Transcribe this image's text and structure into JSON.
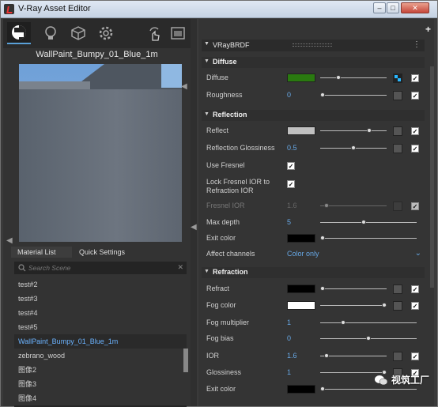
{
  "window": {
    "title": "V-Ray Asset Editor"
  },
  "toolbar": {
    "icons": [
      "materials-icon",
      "lights-icon",
      "geometry-icon",
      "settings-icon",
      "render-interactive-icon",
      "frame-buffer-icon"
    ]
  },
  "preview": {
    "title": "WallPaint_Bumpy_01_Blue_1m"
  },
  "left_tabs": [
    {
      "label": "Material List"
    },
    {
      "label": "Quick Settings"
    }
  ],
  "search": {
    "placeholder": "Search Scene"
  },
  "materials": [
    {
      "label": "test#2"
    },
    {
      "label": "test#3"
    },
    {
      "label": "test#4"
    },
    {
      "label": "test#5"
    },
    {
      "label": "WallPaint_Bumpy_01_Blue_1m",
      "selected": true
    },
    {
      "label": "zebrano_wood"
    },
    {
      "label": "图像2"
    },
    {
      "label": "图像3"
    },
    {
      "label": "图像4"
    }
  ],
  "editor": {
    "plus": "+",
    "header": "VRayBRDF",
    "menu": "⋮",
    "diffuse": {
      "title": "Diffuse",
      "diffuse_label": "Diffuse",
      "diffuse_color": "#2a7a10",
      "diffuse_slider": 0.25,
      "roughness_label": "Roughness",
      "roughness_value": "0",
      "roughness_slider": 0.0
    },
    "reflection": {
      "title": "Reflection",
      "reflect_label": "Reflect",
      "reflect_color": "#c0c0c0",
      "reflect_slider": 0.75,
      "gloss_label": "Reflection Glossiness",
      "gloss_value": "0.5",
      "gloss_slider": 0.5,
      "fresnel_label": "Use Fresnel",
      "lock_label_1": "Lock Fresnel IOR to",
      "lock_label_2": "Refraction IOR",
      "fresnel_ior_label": "Fresnel IOR",
      "fresnel_ior_value": "1.6",
      "fresnel_ior_slider": 0.06,
      "depth_label": "Max depth",
      "depth_value": "5",
      "depth_slider": 0.45,
      "exit_label": "Exit color",
      "exit_color": "#000000",
      "exit_slider": 0.0,
      "channels_label": "Affect channels",
      "channels_value": "Color only"
    },
    "refraction": {
      "title": "Refraction",
      "refract_label": "Refract",
      "refract_color": "#000000",
      "refract_slider": 0.0,
      "fog_label": "Fog color",
      "fog_color": "#ffffff",
      "fog_slider": 1.0,
      "fogmult_label": "Fog multiplier",
      "fogmult_value": "1",
      "fogmult_slider": 0.22,
      "fogbias_label": "Fog bias",
      "fogbias_value": "0",
      "fogbias_slider": 0.5,
      "ior_label": "IOR",
      "ior_value": "1.6",
      "ior_slider": 0.06,
      "gloss_label": "Glossiness",
      "gloss_value": "1",
      "gloss_slider": 1.0,
      "exit_label": "Exit color",
      "exit_color": "#000000",
      "exit_slider": 0.0
    }
  },
  "watermark": {
    "text": "视筑工厂"
  }
}
